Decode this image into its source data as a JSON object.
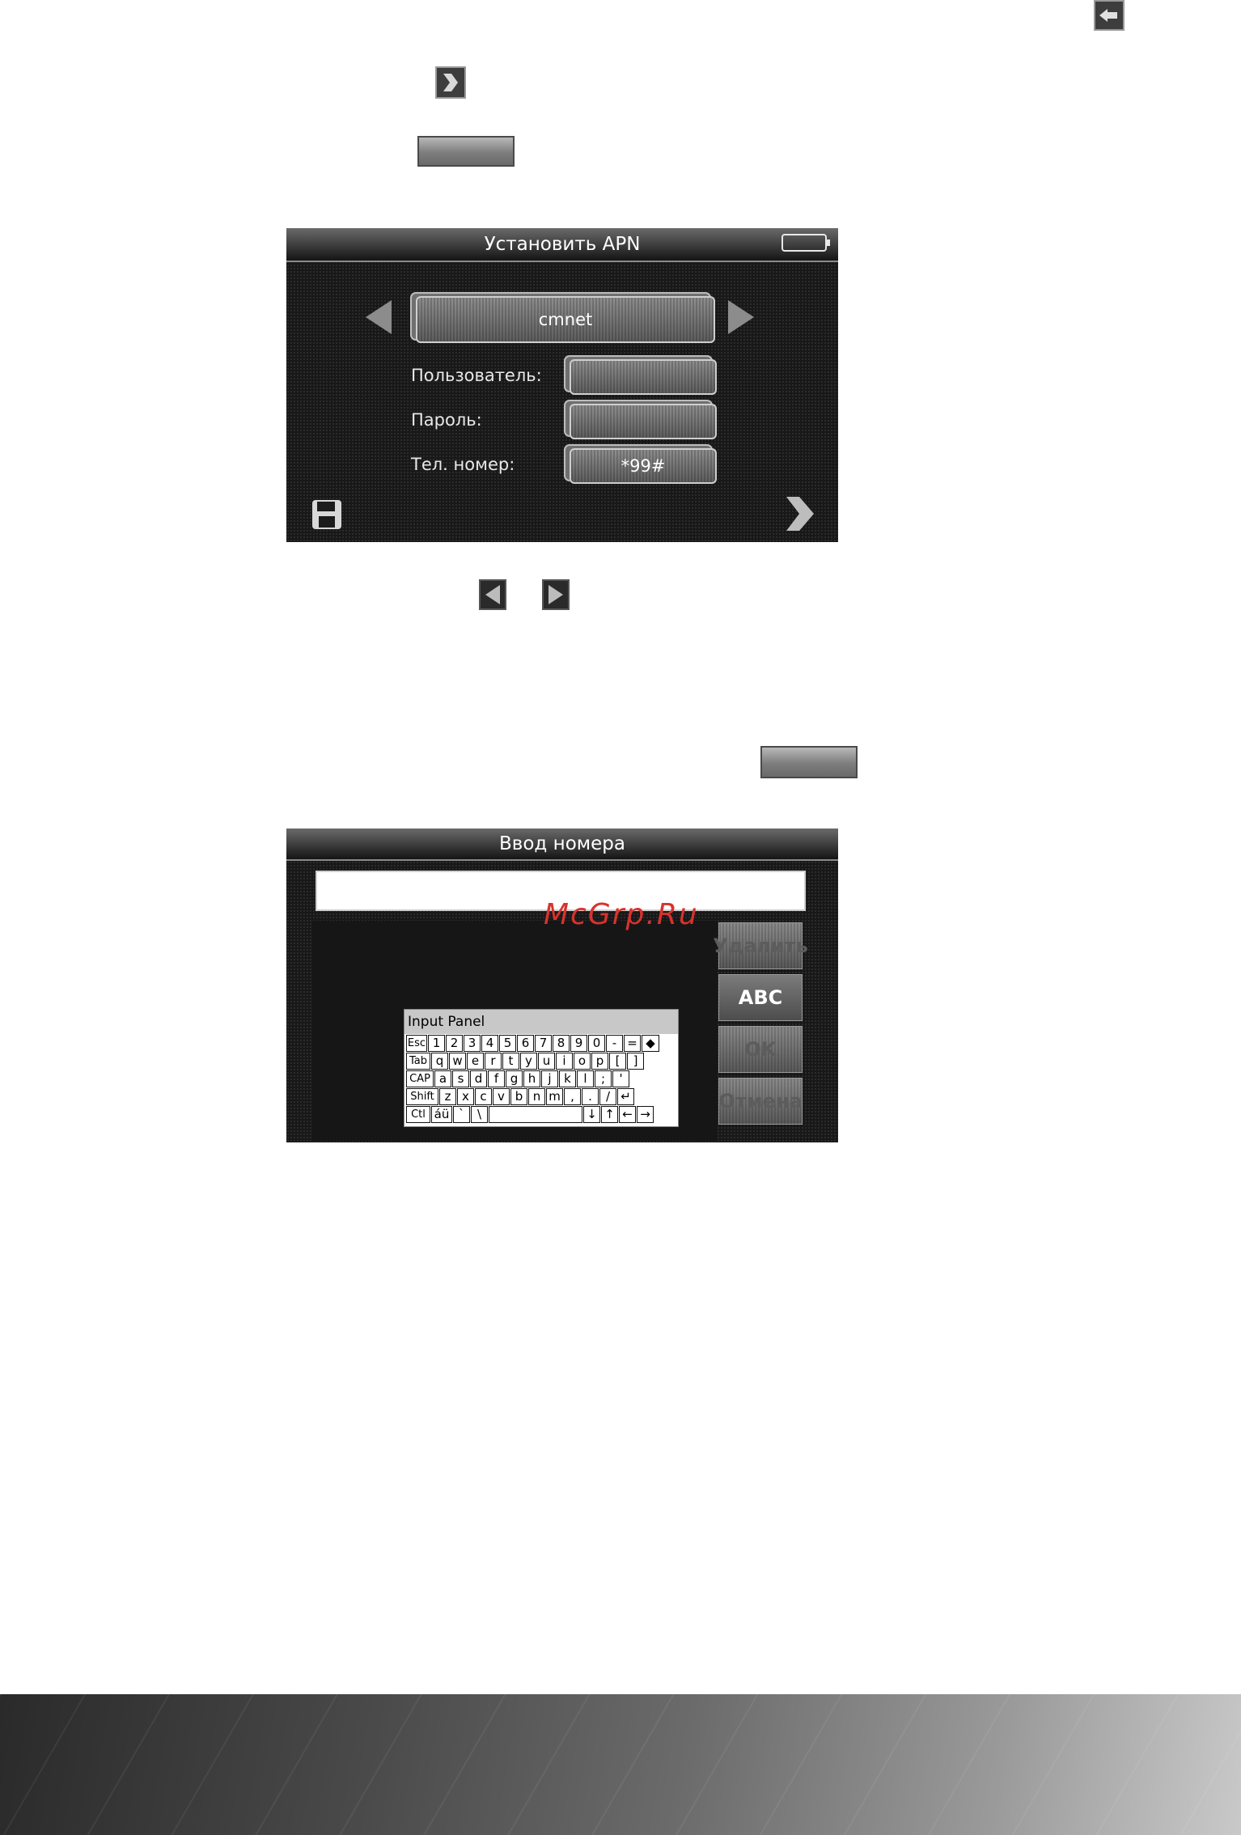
{
  "icons": {
    "back_icon": "back-arrow-icon",
    "next_icon": "next-arrow-icon",
    "prev_small_icon": "left-arrow-icon",
    "next_small_icon": "right-arrow-icon"
  },
  "apn_screen": {
    "title": "Установить APN",
    "apn_value": "cmnet",
    "user_label": "Пользователь:",
    "user_value": "",
    "password_label": "Пароль:",
    "password_value": "",
    "phone_label": "Тел. номер:",
    "phone_value": "*99#"
  },
  "number_screen": {
    "title": "Ввод номера",
    "input_value": "",
    "buttons": {
      "delete": "Удалить",
      "abc": "ABC",
      "ok": "OK",
      "cancel": "Отмена"
    },
    "keyboard": {
      "title": "Input Panel",
      "row1": [
        "Esc",
        "1",
        "2",
        "3",
        "4",
        "5",
        "6",
        "7",
        "8",
        "9",
        "0",
        "-",
        "=",
        "◆"
      ],
      "row2": [
        "Tab",
        "q",
        "w",
        "e",
        "r",
        "t",
        "y",
        "u",
        "i",
        "o",
        "p",
        "[",
        "]"
      ],
      "row3": [
        "CAP",
        "a",
        "s",
        "d",
        "f",
        "g",
        "h",
        "j",
        "k",
        "l",
        ";",
        "'"
      ],
      "row4": [
        "Shift",
        "z",
        "x",
        "c",
        "v",
        "b",
        "n",
        "m",
        ",",
        ".",
        "/",
        "↵"
      ],
      "row5": [
        "Ctl",
        "áü",
        "`",
        "\\",
        "",
        "↓",
        "↑",
        "←",
        "→"
      ]
    }
  },
  "watermark": "McGrp.Ru"
}
